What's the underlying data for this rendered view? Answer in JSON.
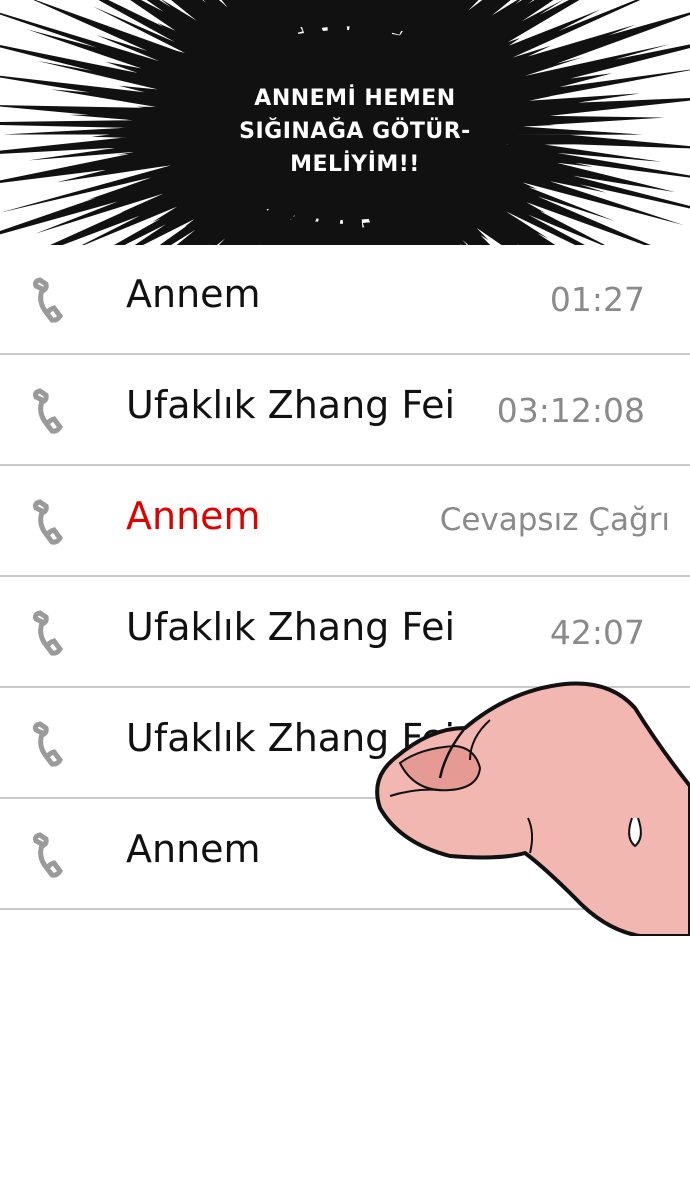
{
  "speech_bubble": {
    "lines": [
      "ANNEMİ HEMEN",
      "SIĞINAĞA GÖTÜR-",
      "MELİYİM!!"
    ]
  },
  "call_log": [
    {
      "name": "Annem",
      "detail": "01:27",
      "missed": false,
      "icon": "phone-handset-icon"
    },
    {
      "name": "Ufaklık Zhang Fei",
      "detail": "03:12:08",
      "missed": false,
      "icon": "phone-handset-icon"
    },
    {
      "name": "Annem",
      "detail": "Cevapsız Çağrı",
      "missed": true,
      "icon": "phone-handset-icon"
    },
    {
      "name": "Ufaklık Zhang Fei",
      "detail": "42:07",
      "missed": false,
      "icon": "phone-handset-icon"
    },
    {
      "name": "Ufaklık Zhang Fei",
      "detail": "",
      "missed": false,
      "icon": "phone-handset-icon"
    },
    {
      "name": "Annem",
      "detail": "",
      "missed": false,
      "icon": "phone-handset-icon"
    }
  ],
  "colors": {
    "missed": "#e00000",
    "divider": "#c9c9c9",
    "detail": "#8a8a8a",
    "icon": "#9a9a9a"
  }
}
